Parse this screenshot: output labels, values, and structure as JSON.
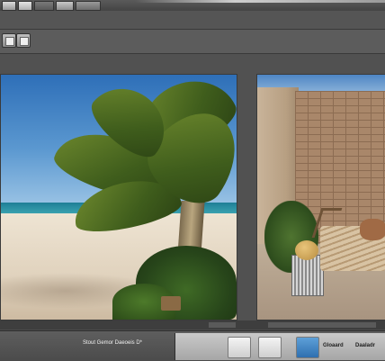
{
  "menubar": {
    "items": [
      {
        "label": "",
        "icon": "home-icon"
      },
      {
        "label": "",
        "icon": "image-icon"
      },
      {
        "label": "",
        "icon": "layers-icon"
      },
      {
        "label": "",
        "icon": "frame-icon"
      }
    ],
    "texts": [
      "",
      "",
      "",
      "",
      "",
      ""
    ]
  },
  "toolbar": {
    "tools": [
      {
        "icon": "crop-icon"
      },
      {
        "icon": "select-icon"
      }
    ]
  },
  "workspace": {
    "left_image": {
      "icon": "beach-palm-photo"
    },
    "right_image": {
      "icon": "patio-bench-photo"
    }
  },
  "bottom_bar": {
    "document_label": "Stout Gemor Daeoeis D*",
    "dock_items": [
      {
        "icon": "card-icon"
      },
      {
        "icon": "monitor-icon"
      },
      {
        "icon": "display-icon"
      }
    ],
    "dock_labels": [
      "Gloaard",
      "Daaladr"
    ]
  },
  "colors": {
    "chrome": "#4a4a4a",
    "panel": "#555555",
    "dock": "#bdbdbd"
  }
}
